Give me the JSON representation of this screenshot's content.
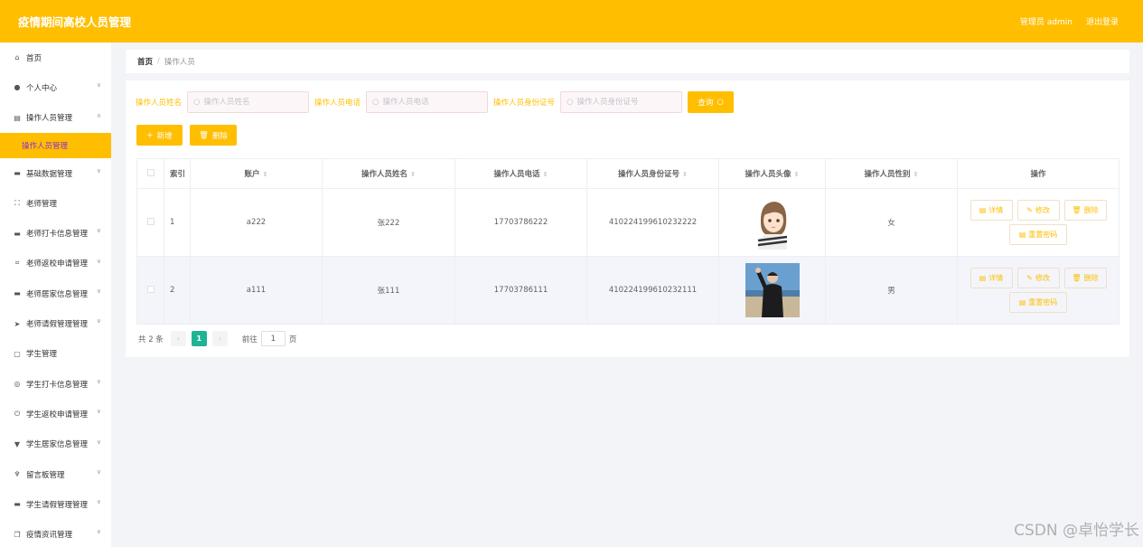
{
  "header": {
    "title": "疫情期间高校人员管理",
    "user": "管理员 admin",
    "logout": "退出登录"
  },
  "sidebar": {
    "items": [
      {
        "label": "首页",
        "icon": "home-icon",
        "glyph": "⌂",
        "expandable": false
      },
      {
        "label": "个人中心",
        "icon": "user-icon",
        "glyph": "●",
        "expandable": true
      },
      {
        "label": "操作人员管理",
        "icon": "document-icon",
        "glyph": "▤",
        "expandable": true,
        "open": true
      },
      {
        "label": "基础数据管理",
        "icon": "suitcase-icon",
        "glyph": "▬",
        "expandable": true
      },
      {
        "label": "老师管理",
        "icon": "fullscreen-icon",
        "glyph": "⛶",
        "expandable": false
      },
      {
        "label": "老师打卡信息管理",
        "icon": "chat-icon",
        "glyph": "▬",
        "expandable": true
      },
      {
        "label": "老师返校申请管理",
        "icon": "crop-icon",
        "glyph": "⌗",
        "expandable": true
      },
      {
        "label": "老师居家信息管理",
        "icon": "ticket-icon",
        "glyph": "▬",
        "expandable": true
      },
      {
        "label": "老师请假管理管理",
        "icon": "send-icon",
        "glyph": "➤",
        "expandable": true
      },
      {
        "label": "学生管理",
        "icon": "message-icon",
        "glyph": "▢",
        "expandable": false
      },
      {
        "label": "学生打卡信息管理",
        "icon": "compass-icon",
        "glyph": "◎",
        "expandable": true
      },
      {
        "label": "学生返校申请管理",
        "icon": "power-icon",
        "glyph": "⏻",
        "expandable": true
      },
      {
        "label": "学生居家信息管理",
        "icon": "cup-icon",
        "glyph": "▼",
        "expandable": true
      },
      {
        "label": "留言板管理",
        "icon": "microphone-icon",
        "glyph": "♆",
        "expandable": true
      },
      {
        "label": "学生请假管理管理",
        "icon": "coin-icon",
        "glyph": "▬",
        "expandable": true
      },
      {
        "label": "疫情资讯管理",
        "icon": "copy-icon",
        "glyph": "❐",
        "expandable": true
      }
    ],
    "sub_active": "操作人员管理"
  },
  "breadcrumb": {
    "home": "首页",
    "separator": "/",
    "current": "操作人员"
  },
  "search": {
    "name_label": "操作人员姓名",
    "name_placeholder": "操作人员姓名",
    "phone_label": "操作人员电话",
    "phone_placeholder": "操作人员电话",
    "id_label": "操作人员身份证号",
    "id_placeholder": "操作人员身份证号",
    "query_label": "查询"
  },
  "actions": {
    "add_label": "新增",
    "delete_label": "删除"
  },
  "table": {
    "headers": {
      "index": "索引",
      "account": "账户",
      "name": "操作人员姓名",
      "phone": "操作人员电话",
      "idcard": "操作人员身份证号",
      "avatar": "操作人员头像",
      "gender": "操作人员性别",
      "ops": "操作"
    },
    "rows": [
      {
        "index": "1",
        "account": "a222",
        "name": "张222",
        "phone": "17703786222",
        "idcard": "410224199610232222",
        "gender": "女"
      },
      {
        "index": "2",
        "account": "a111",
        "name": "张111",
        "phone": "17703786111",
        "idcard": "410224199610232111",
        "gender": "男"
      }
    ],
    "ops": {
      "detail": "详情",
      "edit": "修改",
      "delete": "删除",
      "reset": "重置密码"
    }
  },
  "pagination": {
    "total": "共 2 条",
    "current_page": "1",
    "goto_label": "前往",
    "goto_value": "1",
    "page_suffix": "页"
  },
  "watermark": "CSDN @卓怡学长",
  "colors": {
    "primary": "#ffbe00",
    "active_text": "#8e2dcf",
    "page_active": "#1fb394"
  }
}
